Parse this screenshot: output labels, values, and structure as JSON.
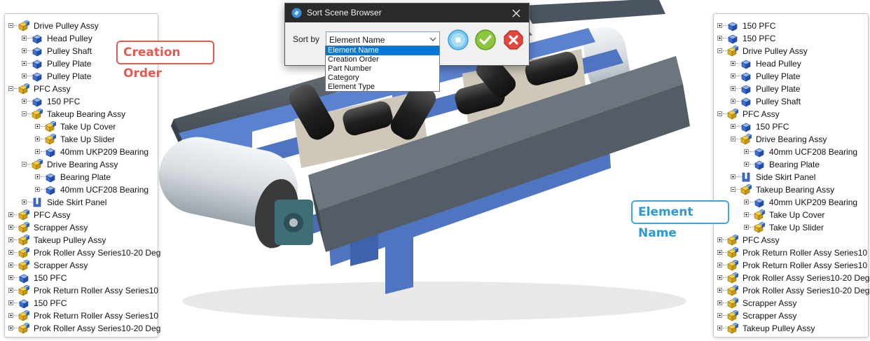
{
  "dialog": {
    "title": "Sort Scene Browser",
    "sort_by_label": "Sort by",
    "selected_value": "Element Name",
    "options": [
      "Element Name",
      "Creation Order",
      "Part Number",
      "Category",
      "Element Type"
    ],
    "buttons": [
      "reset",
      "ok",
      "cancel"
    ]
  },
  "callouts": {
    "creation": "Creation Order",
    "element": "Element Name"
  },
  "left_tree": [
    {
      "label": "Drive Pulley Assy",
      "level": 0,
      "icon": "assembly-icon",
      "expanded": true
    },
    {
      "label": "Head Pulley",
      "level": 1,
      "icon": "part-icon",
      "expanded": false
    },
    {
      "label": "Pulley Shaft",
      "level": 1,
      "icon": "part-icon",
      "expanded": false
    },
    {
      "label": "Pulley Plate",
      "level": 1,
      "icon": "part-icon",
      "expanded": false
    },
    {
      "label": "Pulley Plate",
      "level": 1,
      "icon": "part-icon",
      "expanded": false
    },
    {
      "label": "PFC Assy",
      "level": 0,
      "icon": "assembly-icon",
      "expanded": true
    },
    {
      "label": "150 PFC",
      "level": 1,
      "icon": "part-icon",
      "expanded": false
    },
    {
      "label": "Takeup Bearing Assy",
      "level": 1,
      "icon": "assembly-icon",
      "expanded": true
    },
    {
      "label": "Take Up Cover",
      "level": 2,
      "icon": "assembly-icon",
      "expanded": false
    },
    {
      "label": "Take Up Slider",
      "level": 2,
      "icon": "assembly-icon",
      "expanded": false
    },
    {
      "label": "40mm UKP209 Bearing",
      "level": 2,
      "icon": "part-icon",
      "expanded": false
    },
    {
      "label": "Drive Bearing Assy",
      "level": 1,
      "icon": "assembly-icon",
      "expanded": true
    },
    {
      "label": "Bearing Plate",
      "level": 2,
      "icon": "part-icon",
      "expanded": false
    },
    {
      "label": "40mm UCF208 Bearing",
      "level": 2,
      "icon": "part-icon",
      "expanded": false
    },
    {
      "label": "Side Skirt Panel",
      "level": 1,
      "icon": "sheet-metal-icon",
      "expanded": false
    },
    {
      "label": "PFC Assy",
      "level": 0,
      "icon": "assembly-icon",
      "expanded": false
    },
    {
      "label": "Scrapper Assy",
      "level": 0,
      "icon": "assembly-icon",
      "expanded": false
    },
    {
      "label": "Takeup Pulley Assy",
      "level": 0,
      "icon": "assembly-icon",
      "expanded": false
    },
    {
      "label": "Prok Roller Assy Series10-20 Deg",
      "level": 0,
      "icon": "assembly-icon",
      "expanded": false
    },
    {
      "label": "Scrapper Assy",
      "level": 0,
      "icon": "assembly-icon",
      "expanded": false
    },
    {
      "label": "150 PFC",
      "level": 0,
      "icon": "part-icon",
      "expanded": false
    },
    {
      "label": "Prok Return Roller Assy Series10",
      "level": 0,
      "icon": "assembly-icon",
      "expanded": false
    },
    {
      "label": "150 PFC",
      "level": 0,
      "icon": "part-icon",
      "expanded": false
    },
    {
      "label": "Prok Return Roller Assy Series10",
      "level": 0,
      "icon": "assembly-icon",
      "expanded": false
    },
    {
      "label": "Prok Roller Assy Series10-20 Deg",
      "level": 0,
      "icon": "assembly-icon",
      "expanded": false
    }
  ],
  "right_tree": [
    {
      "label": "150 PFC",
      "level": 0,
      "icon": "part-icon",
      "expanded": false
    },
    {
      "label": "150 PFC",
      "level": 0,
      "icon": "part-icon",
      "expanded": false
    },
    {
      "label": "Drive Pulley Assy",
      "level": 0,
      "icon": "assembly-icon",
      "expanded": true
    },
    {
      "label": "Head Pulley",
      "level": 1,
      "icon": "part-icon",
      "expanded": false
    },
    {
      "label": "Pulley Plate",
      "level": 1,
      "icon": "part-icon",
      "expanded": false
    },
    {
      "label": "Pulley Plate",
      "level": 1,
      "icon": "part-icon",
      "expanded": false
    },
    {
      "label": "Pulley Shaft",
      "level": 1,
      "icon": "part-icon",
      "expanded": false
    },
    {
      "label": "PFC Assy",
      "level": 0,
      "icon": "assembly-icon",
      "expanded": true
    },
    {
      "label": "150 PFC",
      "level": 1,
      "icon": "part-icon",
      "expanded": false
    },
    {
      "label": "Drive Bearing Assy",
      "level": 1,
      "icon": "assembly-icon",
      "expanded": true
    },
    {
      "label": "40mm UCF208 Bearing",
      "level": 2,
      "icon": "part-icon",
      "expanded": false
    },
    {
      "label": "Bearing Plate",
      "level": 2,
      "icon": "part-icon",
      "expanded": false
    },
    {
      "label": "Side Skirt Panel",
      "level": 1,
      "icon": "sheet-metal-icon",
      "expanded": false
    },
    {
      "label": "Takeup Bearing Assy",
      "level": 1,
      "icon": "assembly-icon",
      "expanded": true
    },
    {
      "label": "40mm UKP209 Bearing",
      "level": 2,
      "icon": "part-icon",
      "expanded": false
    },
    {
      "label": "Take Up Cover",
      "level": 2,
      "icon": "assembly-icon",
      "expanded": false
    },
    {
      "label": "Take Up Slider",
      "level": 2,
      "icon": "assembly-icon",
      "expanded": false
    },
    {
      "label": "PFC Assy",
      "level": 0,
      "icon": "assembly-icon",
      "expanded": false
    },
    {
      "label": "Prok Return Roller Assy Series10",
      "level": 0,
      "icon": "assembly-icon",
      "expanded": false
    },
    {
      "label": "Prok Return Roller Assy Series10",
      "level": 0,
      "icon": "assembly-icon",
      "expanded": false
    },
    {
      "label": "Prok Roller Assy Series10-20 Deg",
      "level": 0,
      "icon": "assembly-icon",
      "expanded": false
    },
    {
      "label": "Prok Roller Assy Series10-20 Deg",
      "level": 0,
      "icon": "assembly-icon",
      "expanded": false
    },
    {
      "label": "Scrapper Assy",
      "level": 0,
      "icon": "assembly-icon",
      "expanded": false
    },
    {
      "label": "Scrapper Assy",
      "level": 0,
      "icon": "assembly-icon",
      "expanded": false
    },
    {
      "label": "Takeup Pulley Assy",
      "level": 0,
      "icon": "assembly-icon",
      "expanded": false
    }
  ],
  "colors": {
    "creation_callout": "#e55a4e",
    "element_callout": "#2c9ad6",
    "frame_blue": "#5b82d0",
    "steel_grey": "#5c6670",
    "selection": "#0078d7"
  }
}
